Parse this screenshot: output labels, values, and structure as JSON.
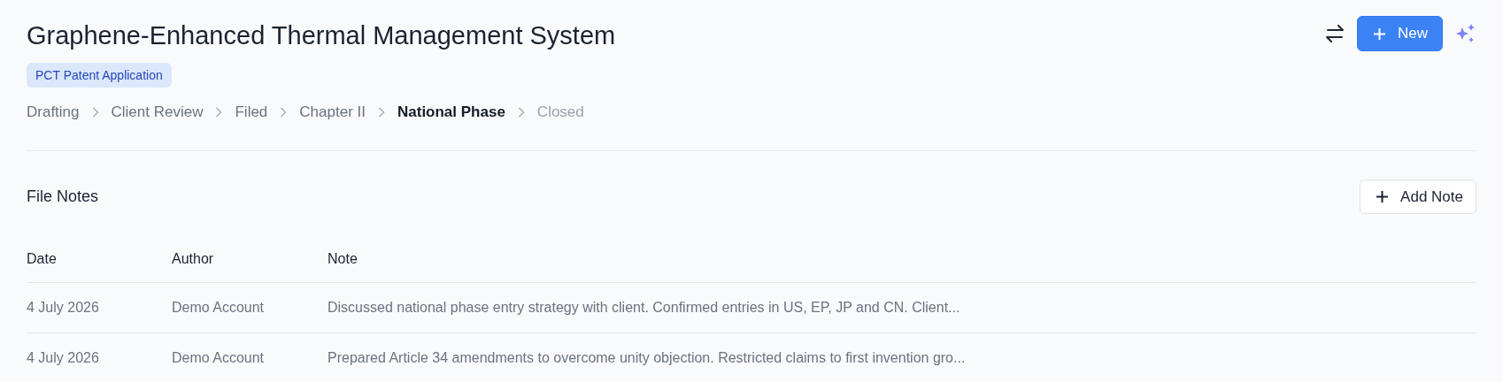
{
  "title": "Graphene-Enhanced Thermal Management System",
  "badge": "PCT Patent Application",
  "stages": [
    {
      "label": "Drafting",
      "selected": false,
      "disabled": false
    },
    {
      "label": "Client Review",
      "selected": false,
      "disabled": false
    },
    {
      "label": "Filed",
      "selected": false,
      "disabled": false
    },
    {
      "label": "Chapter II",
      "selected": false,
      "disabled": false
    },
    {
      "label": "National Phase",
      "selected": true,
      "disabled": false
    },
    {
      "label": "Closed",
      "selected": false,
      "disabled": true
    }
  ],
  "new_button": "New",
  "section": {
    "title": "File Notes",
    "add_button": "Add Note"
  },
  "table": {
    "columns": [
      "Date",
      "Author",
      "Note"
    ],
    "rows": [
      [
        "4 July 2026",
        "Demo Account",
        "Discussed national phase entry strategy with client. Confirmed entries in US, EP, JP and CN. Client..."
      ],
      [
        "4 July 2026",
        "Demo Account",
        "Prepared Article 34 amendments to overcome unity objection. Restricted claims to first invention gro..."
      ]
    ]
  }
}
